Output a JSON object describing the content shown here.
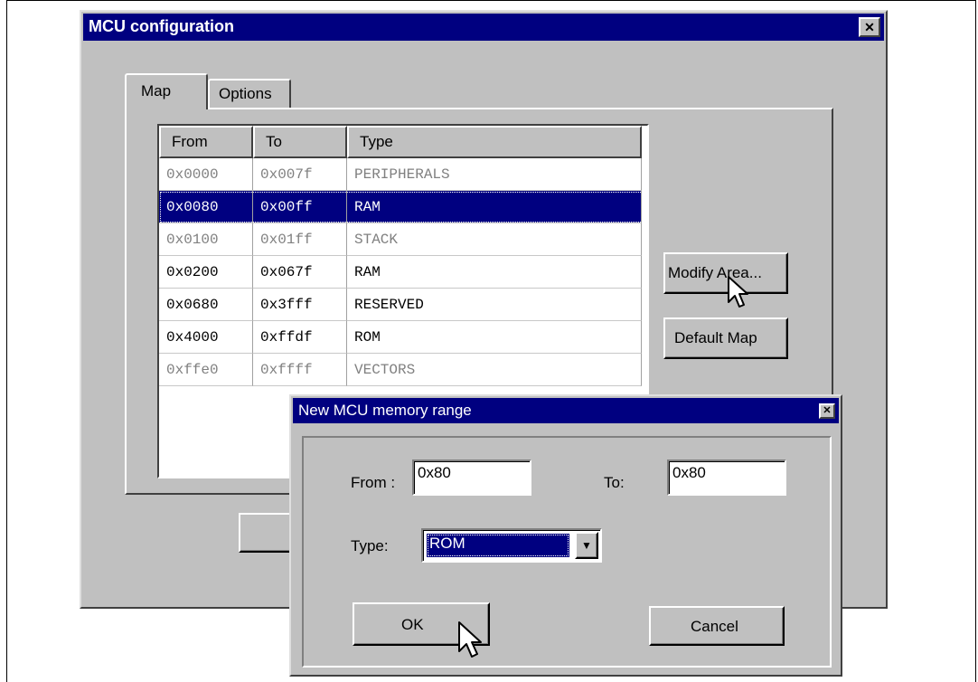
{
  "mcu_config": {
    "title": "MCU configuration",
    "close_glyph": "✕",
    "tabs": [
      {
        "label": "Map",
        "active": true
      },
      {
        "label": "Options",
        "active": false
      }
    ],
    "columns": [
      "From",
      "To",
      "Type"
    ],
    "rows": [
      {
        "from": "0x0000",
        "to": "0x007f",
        "type": "PERIPHERALS",
        "state": "disabled"
      },
      {
        "from": "0x0080",
        "to": "0x00ff",
        "type": "RAM",
        "state": "selected"
      },
      {
        "from": "0x0100",
        "to": "0x01ff",
        "type": "STACK",
        "state": "disabled"
      },
      {
        "from": "0x0200",
        "to": "0x067f",
        "type": "RAM",
        "state": "normal"
      },
      {
        "from": "0x0680",
        "to": "0x3fff",
        "type": "RESERVED",
        "state": "normal"
      },
      {
        "from": "0x4000",
        "to": "0xffdf",
        "type": "ROM",
        "state": "normal"
      },
      {
        "from": "0xffe0",
        "to": "0xffff",
        "type": "VECTORS",
        "state": "disabled"
      }
    ],
    "modify_area_label": "Modify Area...",
    "default_map_label": "Default Map"
  },
  "range_dialog": {
    "title": "New MCU memory range",
    "close_glyph": "✕",
    "from_label": "From :",
    "from_value": "0x80",
    "to_label": "To:",
    "to_value": "0x80",
    "type_label": "Type:",
    "type_value": "ROM",
    "dropdown_glyph": "▼",
    "ok_label": "OK",
    "cancel_label": "Cancel"
  },
  "colors": {
    "titlebar": "#000080",
    "dialog_face": "#c0c0c0",
    "selection": "#000080"
  }
}
